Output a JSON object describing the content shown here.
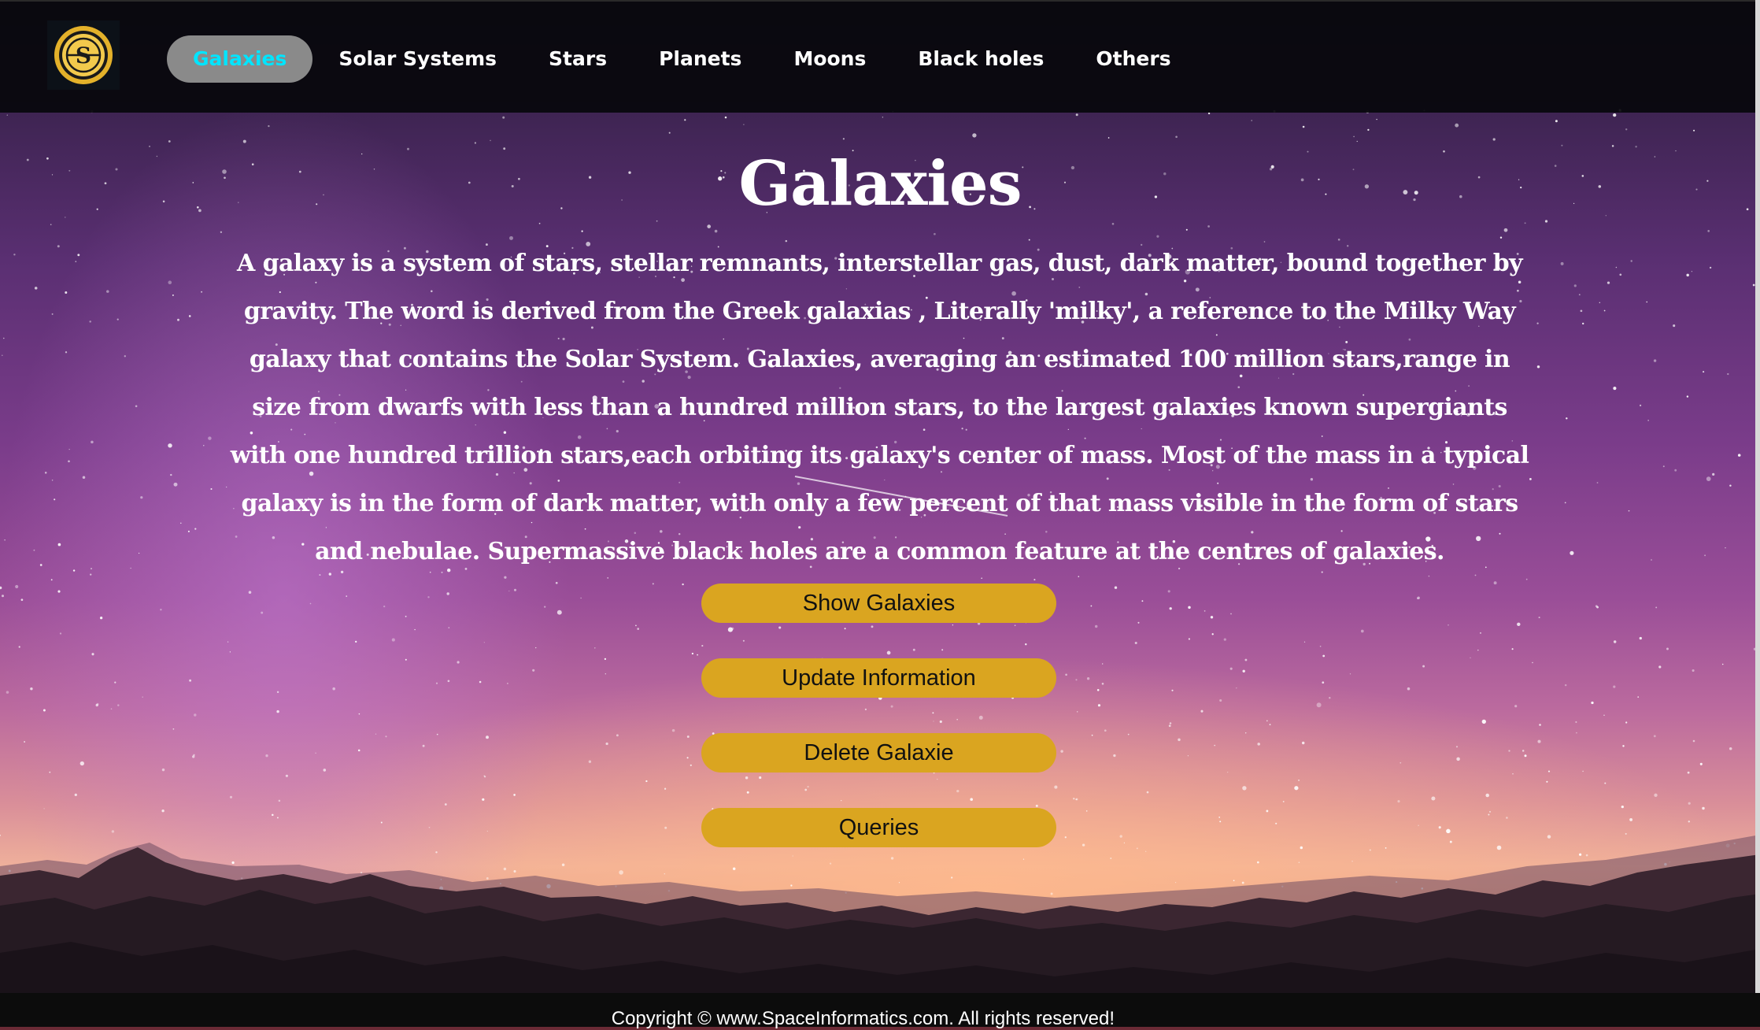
{
  "header": {
    "logo": {
      "icon": "space-informatics-logo-icon",
      "letters": "S",
      "colors": {
        "ring": "#e3b12a",
        "center": "#f2c94c"
      }
    },
    "nav": [
      {
        "label": "Galaxies",
        "active": true
      },
      {
        "label": "Solar Systems",
        "active": false
      },
      {
        "label": "Stars",
        "active": false
      },
      {
        "label": "Planets",
        "active": false
      },
      {
        "label": "Moons",
        "active": false
      },
      {
        "label": "Black holes",
        "active": false
      },
      {
        "label": "Others",
        "active": false
      }
    ],
    "colors": {
      "active_bg": "#8a8a8a",
      "active_text": "#00e5ff"
    }
  },
  "main": {
    "title": "Galaxies",
    "description": "A galaxy is a system of stars, stellar remnants, interstellar gas, dust, dark matter, bound together by gravity. The word is derived from the Greek galaxias , Literally 'milky', a reference to the Milky Way galaxy that contains the Solar System. Galaxies, averaging an estimated 100 million stars,range in size from dwarfs with less than a hundred million stars, to the largest galaxies known supergiants with one hundred trillion stars,each orbiting its galaxy's center of mass. Most of the mass in a typical galaxy is in the form of dark matter, with only a few percent of that mass visible in the form of stars and nebulae. Supermassive black holes are a common feature at the centres of galaxies.",
    "buttons": {
      "show": "Show Galaxies",
      "update": "Update Information",
      "delete": "Delete Galaxie",
      "queries": "Queries"
    },
    "button_color": "#daa520"
  },
  "footer": {
    "copyright": "Copyright © www.SpaceInformatics.com. All rights reserved!"
  }
}
